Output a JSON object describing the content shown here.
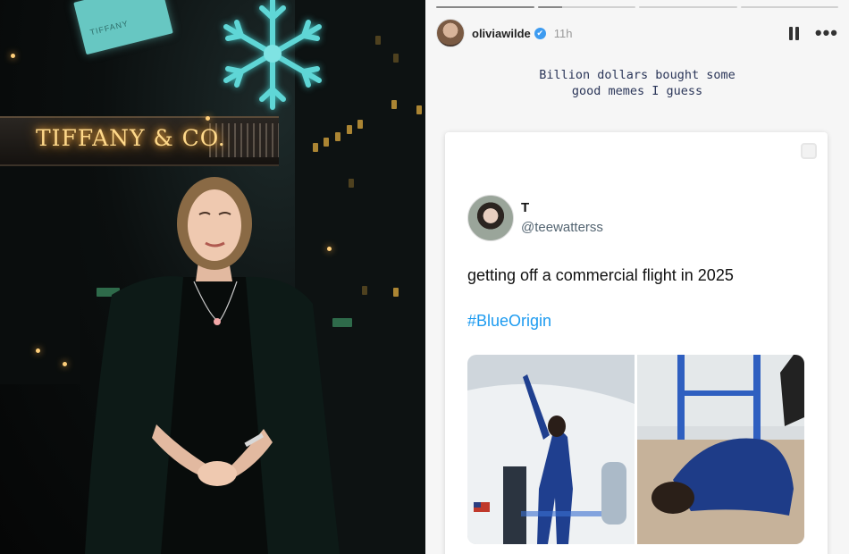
{
  "photo": {
    "store_sign": "TIFFANY & CO.",
    "banner_text": "TIFFANY"
  },
  "story": {
    "username": "oliviawilde",
    "verified_icon": "✔",
    "time": "11h",
    "progress_segments": [
      1,
      0.25,
      0,
      0
    ],
    "caption_lines": [
      "Billion dollars bought some",
      "good memes I guess"
    ]
  },
  "tweet": {
    "name": "T",
    "handle": "@teewatterss",
    "text": "getting off a commercial flight in 2025",
    "hashtag": "#BlueOrigin"
  },
  "colors": {
    "tiffany_blue": "#67c7c2",
    "hashtag": "#1d9bf0",
    "caption": "#2a3558"
  }
}
